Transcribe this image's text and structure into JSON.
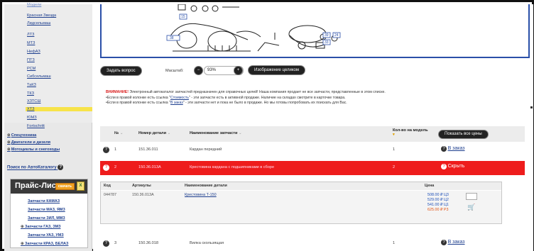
{
  "sidebar": {
    "brands": [
      {
        "label": "Модели",
        "active": false
      },
      {
        "label": "Красная Звезда",
        "active": false
      },
      {
        "label": "Лидсельмаш",
        "active": false
      },
      {
        "label": "ЛТЗ",
        "active": false
      },
      {
        "label": "МТЗ",
        "active": false
      },
      {
        "label": "НефАЗ",
        "active": false
      },
      {
        "label": "ПТЗ",
        "active": false
      },
      {
        "label": "РСМ",
        "active": false
      },
      {
        "label": "Сибсельмаш",
        "active": false
      },
      {
        "label": "ТаКЗ",
        "active": false
      },
      {
        "label": "ТКЗ",
        "active": false
      },
      {
        "label": "ХЗТСШ",
        "active": false
      },
      {
        "label": "ХТЗ",
        "active": true
      },
      {
        "label": "ЮМЗ",
        "active": false
      },
      {
        "label": "Fortschritt",
        "active": false
      }
    ],
    "categories": [
      {
        "label": "Спецтехника"
      },
      {
        "label": "Двигатели и дизеля"
      },
      {
        "label": "Мотоциклы и снегоходы"
      }
    ],
    "catalog_search": "Поиск по АвтоКаталогу",
    "price_list": {
      "title": "Прайс-Лист",
      "download": "скачать",
      "items": [
        {
          "label": "Запчасти КАМАЗ",
          "plus": false
        },
        {
          "label": "Запчасти МАЗ, ЯМЗ",
          "plus": false
        },
        {
          "label": "Запчасти ЗИЛ, ММЗ",
          "plus": false
        },
        {
          "label": "Запчасти ГАЗ, ЗМЗ",
          "plus": true
        },
        {
          "label": "Запчасти УАЗ, УМЗ",
          "plus": false
        },
        {
          "label": "Запчасти КРАЗ, БЕЛАЗ",
          "plus": true
        }
      ]
    }
  },
  "diagram": {
    "callouts": [
      "15",
      "38",
      "39",
      "24",
      "33"
    ]
  },
  "toolbar": {
    "ask_question": "Задать вопрос",
    "scale_label": "Масштаб:",
    "scale_value": "93%",
    "full_image": "Изображение целиком"
  },
  "notice": {
    "warning": "ВНИМАНИЕ!",
    "text": "Электронный автокаталог запчастей предназначен для справочных целей! Наша компания продает не все запчасти, представленные в этом списке.",
    "line1_a": "•Если в правой колонке есть ссылка \"",
    "line1_link": "Стоимость",
    "line1_b": "\" - эти запчасти есть в активной продаже. Наличие на складах смотрите в карточке товара.",
    "line2_a": "•Если в правой колонке есть ссылка \"",
    "line2_link": "В заказ",
    "line2_b": "\" - эти запчасти нет и пока не было в продаже. Но мы готовы попробовать их поискать для Вас."
  },
  "table": {
    "headers": {
      "num": "№",
      "part_number": "Номер детали",
      "part_name": "Наименование запчасти",
      "qty": "Кол-во на модель",
      "show_all": "Показать все цены"
    },
    "rows": [
      {
        "num": "1",
        "part_number": "151.36.011",
        "name": "Кардан передний",
        "qty": "1",
        "action": "В заказ",
        "highlight": false
      },
      {
        "num": "2",
        "part_number": "150.36.013А",
        "name": "Крестовина кардана с подшипниками в сборе",
        "qty": "2",
        "action": "Скрыть",
        "highlight": true
      },
      {
        "num": "3",
        "part_number": "150.36.018",
        "name": "Вилка скользящая",
        "qty": "1",
        "action": "В заказ",
        "highlight": false
      }
    ],
    "sub_table": {
      "headers": {
        "code": "Код",
        "article": "Артикулы",
        "name": "Наименование детали",
        "price": "Цена"
      },
      "row": {
        "code": "044787",
        "article": "150.36.013А",
        "name": "Крестовина Т-150",
        "prices": [
          {
            "value": "508.00 ₽",
            "tier": "Ц3",
            "red": false
          },
          {
            "value": "529.00 ₽",
            "tier": "Ц2",
            "red": false
          },
          {
            "value": "541.00 ₽",
            "tier": "Ц1",
            "red": false
          },
          {
            "value": "625.00 ₽",
            "tier": "Р3",
            "red": true
          }
        ]
      }
    }
  }
}
